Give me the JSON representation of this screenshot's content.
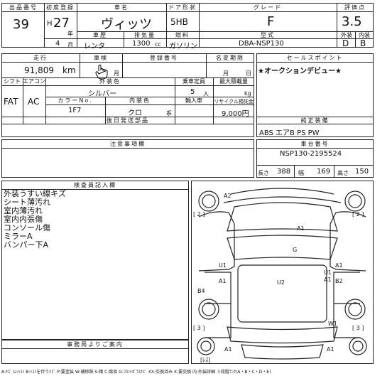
{
  "header": {
    "lot_label": "出品番号",
    "lot": "39",
    "first_reg_label": "初度登録",
    "era": "H",
    "year": "27",
    "year_unit": "年",
    "month": "4",
    "month_unit": "月",
    "name_label": "車名",
    "name": "ヴィッツ",
    "door_label": "ドア形状",
    "door": "5HB",
    "grade_label": "グレード",
    "grade": "F",
    "score_label": "評価点",
    "score": "3.5",
    "history_label": "車歴",
    "history": "レンタ",
    "displacement_label": "排気量",
    "displacement": "1300",
    "displacement_unit": "cc",
    "fuel_label": "燃料",
    "fuel": "ガソリン",
    "model_label": "型式",
    "model": "DBA-NSP130",
    "exterior_label": "外装",
    "exterior": "D",
    "interior_label": "内装",
    "interior": "B"
  },
  "row2": {
    "mileage_label": "走行",
    "mileage": "91,809",
    "mileage_unit": "km",
    "inspection_label": "車検",
    "inspection_unit": "月",
    "reg_no_label": "登録番号",
    "change_label": "名変期限",
    "change_month": "月",
    "change_day": "日",
    "sales_point_label": "セールスポイント",
    "sales_point": "★オークションデビュー★",
    "shift_label": "シフト",
    "shift": "FAT",
    "ac_label": "エアコン",
    "ac": "AC",
    "color_label": "外装色",
    "color": "シルバー",
    "capacity_label": "乗車定員",
    "capacity": "5",
    "capacity_unit": "人",
    "load_label": "最大積載量",
    "load_unit": "kg",
    "color_no_label": "カラーNo.",
    "color_no": "1F7",
    "int_color_label": "内装色",
    "int_color": "クロ",
    "int_color_suffix": "系",
    "import_label": "輸入車",
    "recycle_label": "リサイクル預託金",
    "recycle": "9,000円",
    "docs_label": "後日発送部品",
    "equipment_label": "純正装備",
    "equipment": "ABS エアB PS PW"
  },
  "notes": {
    "caution_label": "注意事項欄",
    "chassis_label": "車台番号",
    "chassis": "NSP130-2195524",
    "length_label": "長さ",
    "length": "388",
    "width_label": "幅",
    "width": "169",
    "height_label": "高さ",
    "height": "150",
    "inspector_label": "検査員記入欄",
    "inspector_lines": [
      "外装うすい線キズ",
      "シート薄汚れ",
      "室内薄汚れ",
      "室内内張傷",
      "コンソール傷",
      "ミラーA",
      "バンパー下A"
    ],
    "office_label": "事務局よりご案内",
    "legend": "A:ｷｽﾞ U:ﾍｺﾐ B:ﾍｺﾐを伴うｷｽﾞ P:要塗装 W:補修跡 S:錆 C:腐食 G:ﾌﾛﾝﾄｶﾞﾗｽｷｽﾞ XX:交換済み X:要交換 内:外装詳細 ３段階ﾗﾝｸ(A・B・C・D・E)"
  },
  "diagram": {
    "marks": [
      "A2",
      "A1",
      "G",
      "U1",
      "A1",
      "U1",
      "A1",
      "A1",
      "U2",
      "B2",
      "B4",
      "W1",
      "A1",
      "A1"
    ],
    "bracket_left_top": "[ 2 ]",
    "bracket_right_top": "[ 2 ]",
    "bracket_left_bottom": "[ 3 ]",
    "bracket_right_bottom": "[ 3 ]",
    "spare_label": "[ﾚｽ]"
  }
}
